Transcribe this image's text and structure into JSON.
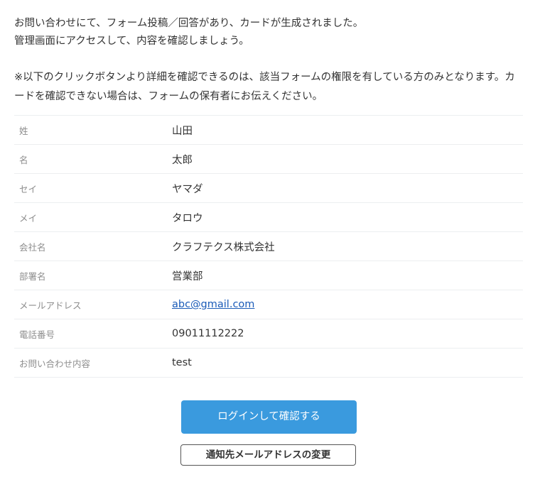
{
  "intro": {
    "line1": "お問い合わせにて、フォーム投稿／回答があり、カードが生成されました。",
    "line2": "管理画面にアクセスして、内容を確認しましょう。"
  },
  "notice": "※以下のクリックボタンより詳細を確認できるのは、該当フォームの権限を有している方のみとなります。カードを確認できない場合は、フォームの保有者にお伝えください。",
  "fields": [
    {
      "label": "姓",
      "value": "山田"
    },
    {
      "label": "名",
      "value": "太郎"
    },
    {
      "label": "セイ",
      "value": "ヤマダ"
    },
    {
      "label": "メイ",
      "value": "タロウ"
    },
    {
      "label": "会社名",
      "value": "クラフテクス株式会社"
    },
    {
      "label": "部署名",
      "value": "営業部"
    },
    {
      "label": "メールアドレス",
      "value": "abc@gmail.com"
    },
    {
      "label": "電話番号",
      "value": "09011112222"
    },
    {
      "label": "お問い合わせ内容",
      "value": "test"
    }
  ],
  "buttons": {
    "login_confirm": "ログインして確認する",
    "change_notify_email": "通知先メールアドレスの変更"
  },
  "colors": {
    "primary_button": "#3a9ade",
    "link": "#1a5bb8",
    "label_text": "#8d8d8d",
    "divider": "#eceef0"
  }
}
